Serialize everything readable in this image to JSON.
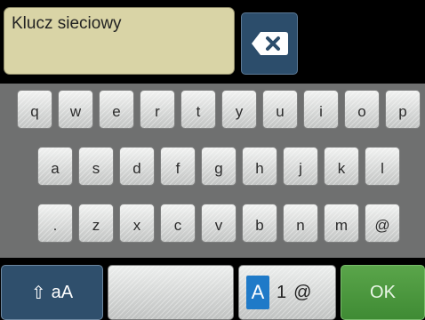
{
  "input": {
    "value": "Klucz sieciowy"
  },
  "backspace": {
    "icon": "backspace-icon"
  },
  "rows": [
    [
      "q",
      "w",
      "e",
      "r",
      "t",
      "y",
      "u",
      "i",
      "o",
      "p"
    ],
    [
      "a",
      "s",
      "d",
      "f",
      "g",
      "h",
      "j",
      "k",
      "l"
    ],
    [
      ".",
      "z",
      "x",
      "c",
      "v",
      "b",
      "n",
      "m",
      "@"
    ]
  ],
  "shift": {
    "arrow": "⇧",
    "label": "aA"
  },
  "mode": {
    "a": "A",
    "b": "1",
    "c": "@"
  },
  "ok": {
    "label": "OK"
  },
  "colors": {
    "input_bg": "#d9d4a6",
    "blue_key": "#2f4f6c",
    "ok_green": "#4d9a40",
    "mode_active": "#1f7ac8"
  }
}
